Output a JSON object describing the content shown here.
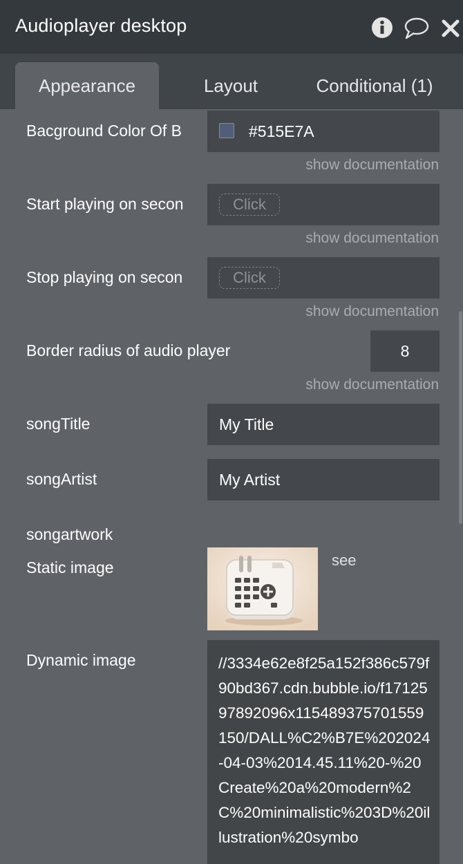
{
  "window": {
    "title": "Audioplayer desktop",
    "icons": [
      "info-icon",
      "comment-icon",
      "close-icon"
    ]
  },
  "tabs": [
    {
      "label": "Appearance",
      "active": true
    },
    {
      "label": "Layout",
      "active": false
    },
    {
      "label": "Conditional (1)",
      "active": false
    }
  ],
  "fields": {
    "bg_color": {
      "label": "Bacground Color Of B",
      "value": "#515E7A",
      "doc": "show documentation"
    },
    "start_playing": {
      "label": "Start playing on secon",
      "placeholder": "Click",
      "doc": "show documentation"
    },
    "stop_playing": {
      "label": "Stop playing on secon",
      "placeholder": "Click",
      "doc": "show documentation"
    },
    "border_radius": {
      "label": "Border radius of audio player",
      "value": "8",
      "doc": "show documentation"
    },
    "song_title": {
      "label": "songTitle",
      "value": "My Title"
    },
    "song_artist": {
      "label": "songArtist",
      "value": "My Artist"
    },
    "song_artwork": {
      "label": "songartwork",
      "static_label": "Static image",
      "see_link": "see",
      "dynamic_label": "Dynamic image",
      "dynamic_value": "//3334e62e8f25a152f386c579f90bd367.cdn.bubble.io/f1712597892096x115489375701559150/DALL%C2%B7E%202024-04-03%2014.45.11%20-%20Create%20a%20modern%2C%20minimalistic%203D%20illustration%20symbo"
    }
  },
  "colors": {
    "panel_bg": "#5f6368",
    "titlebar_bg": "#34393d",
    "tabbar_bg": "#404549",
    "field_bg": "#44484c",
    "swatch": "#515E7A"
  }
}
